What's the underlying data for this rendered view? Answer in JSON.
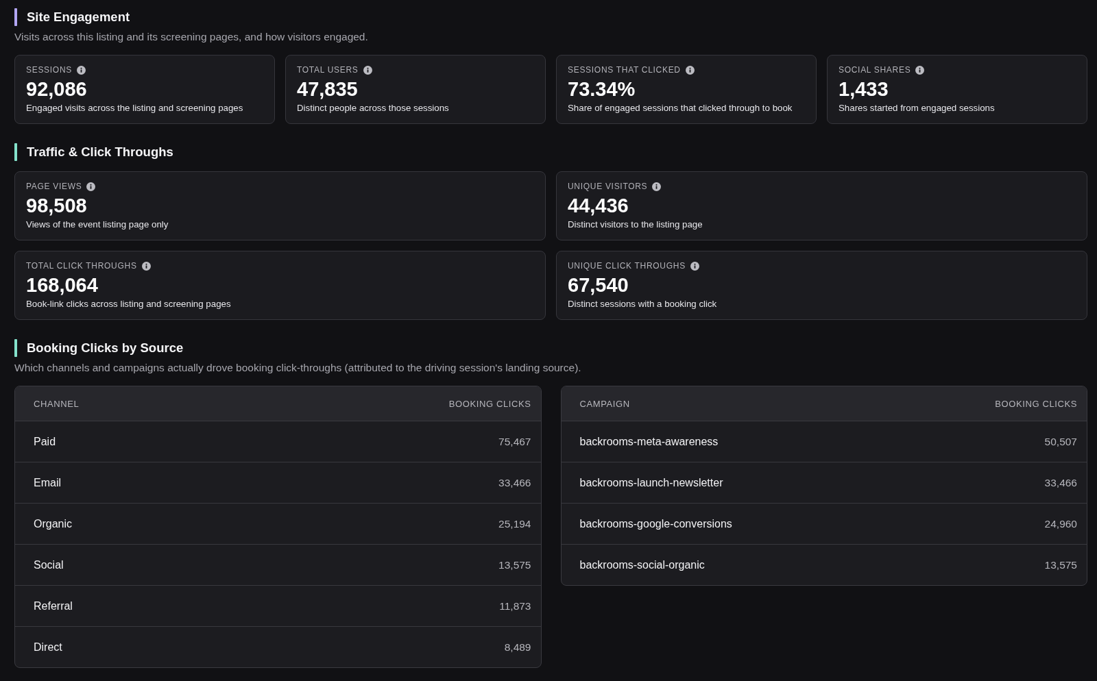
{
  "sections": [
    {
      "kind": "stat_row",
      "title": "Site Engagement",
      "color": "#b2a6f4",
      "subtitle": "Visits across this listing and its screening pages, and how visitors engaged.",
      "cards": [
        {
          "label": "SESSIONS",
          "value": "92,086",
          "description": "Engaged visits across the listing and screening pages"
        },
        {
          "label": "TOTAL USERS",
          "value": "47,835",
          "description": "Distinct people across those sessions"
        },
        {
          "label": "SESSIONS THAT CLICKED",
          "value": "73.34%",
          "description": "Share of engaged sessions that clicked through to book"
        },
        {
          "label": "SOCIAL SHARES",
          "value": "1,433",
          "description": "Shares started from engaged sessions"
        }
      ]
    },
    {
      "kind": "stat_grid",
      "title": "Traffic & Click Throughs",
      "color": "#84e2cb",
      "cards": [
        {
          "label": "PAGE VIEWS",
          "value": "98,508",
          "description": "Views of the event listing page only"
        },
        {
          "label": "UNIQUE VISITORS",
          "value": "44,436",
          "description": "Distinct visitors to the listing page"
        },
        {
          "label": "TOTAL CLICK THROUGHS",
          "value": "168,064",
          "description": "Book-link clicks across listing and screening pages"
        },
        {
          "label": "UNIQUE CLICK THROUGHS",
          "value": "67,540",
          "description": "Distinct sessions with a booking click"
        }
      ]
    },
    {
      "kind": "tables",
      "title": "Booking Clicks by Source",
      "color": "#84e2cb",
      "subtitle": "Which channels and campaigns actually drove booking click-throughs (attributed to the driving session's landing source).",
      "tables": [
        {
          "columns": [
            "CHANNEL",
            "BOOKING CLICKS"
          ],
          "rows": [
            [
              "Paid",
              "75,467"
            ],
            [
              "Email",
              "33,466"
            ],
            [
              "Organic",
              "25,194"
            ],
            [
              "Social",
              "13,575"
            ],
            [
              "Referral",
              "11,873"
            ],
            [
              "Direct",
              "8,489"
            ]
          ]
        },
        {
          "columns": [
            "CAMPAIGN",
            "BOOKING CLICKS"
          ],
          "rows": [
            [
              "backrooms-meta-awareness",
              "50,507"
            ],
            [
              "backrooms-launch-newsletter",
              "33,466"
            ],
            [
              "backrooms-google-conversions",
              "24,960"
            ],
            [
              "backrooms-social-organic",
              "13,575"
            ]
          ]
        }
      ]
    }
  ]
}
